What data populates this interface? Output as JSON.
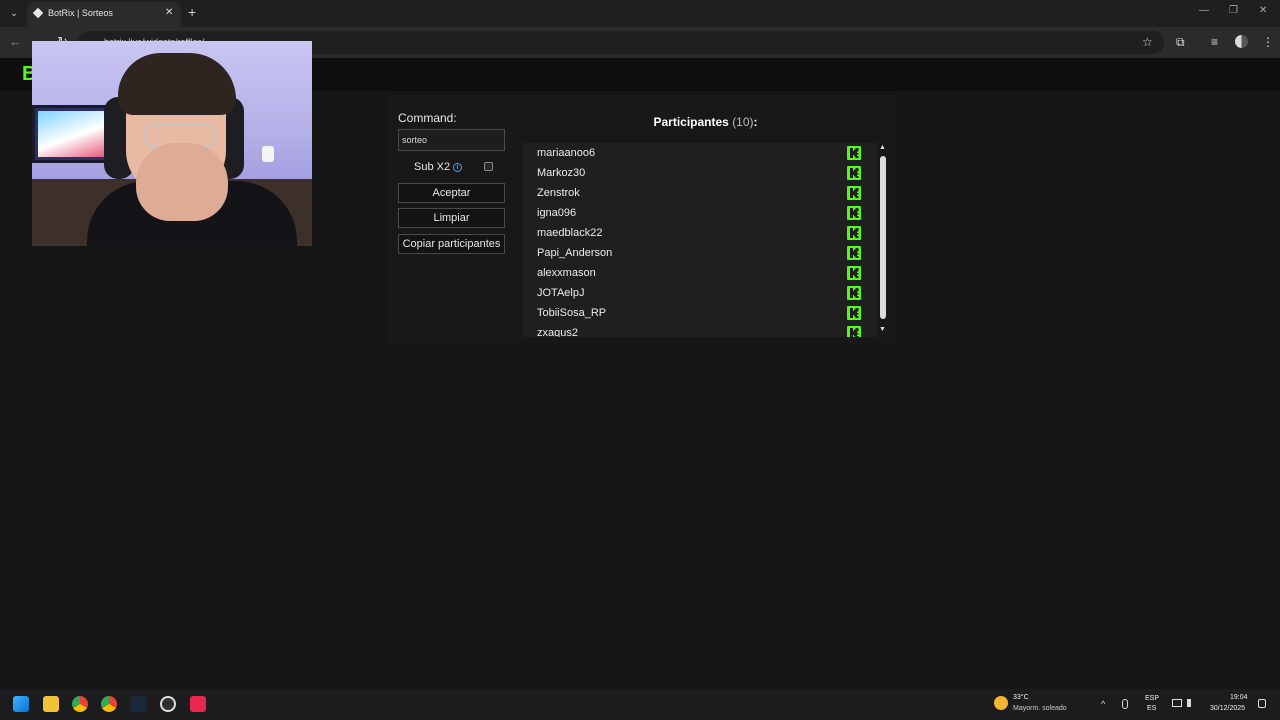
{
  "browser": {
    "tab_title": "BotRix | Sorteos",
    "tab_close": "✕",
    "new_tab": "+",
    "tab_search_icon": "⌄",
    "back": "←",
    "forward": "→",
    "reload": "↻",
    "url": "botrix.live/widgets/raffles/",
    "minimize": "—",
    "restore": "❐",
    "close": "✕",
    "star": "☆",
    "extensions": "⧉",
    "media": "≡",
    "menu": "⋮"
  },
  "site": {
    "logo": "B"
  },
  "raffle": {
    "command_label": "Command:",
    "command_value": "sorteo",
    "sub_label": "Sub X2",
    "info_icon": "i",
    "sub_checked": false,
    "accept_button": "Aceptar",
    "clear_button": "Limpiar",
    "copy_button": "Copiar participantes",
    "participants_title": "Participantes",
    "participants_count": "(10)",
    "participants_colon": ":",
    "participants": [
      {
        "name": "mariaanoo6"
      },
      {
        "name": "Markoz30"
      },
      {
        "name": "Zenstrok"
      },
      {
        "name": "igna096"
      },
      {
        "name": "maedblack22"
      },
      {
        "name": "Papi_Anderson"
      },
      {
        "name": "alexxmason"
      },
      {
        "name": "JOTAelpJ"
      },
      {
        "name": "TobiiSosa_RP"
      },
      {
        "name": "zxagus2"
      }
    ],
    "platform_icon": "kick-icon",
    "accent_color": "#53fc18",
    "scroll_up": "▲",
    "scroll_down": "▼"
  },
  "taskbar": {
    "weather_temp": "33°C",
    "weather_desc": "Mayorm. soleado",
    "chevron": "^",
    "lang_top": "ESP",
    "lang_bottom": "ES",
    "time": "19:04",
    "date": "30/12/2025"
  }
}
